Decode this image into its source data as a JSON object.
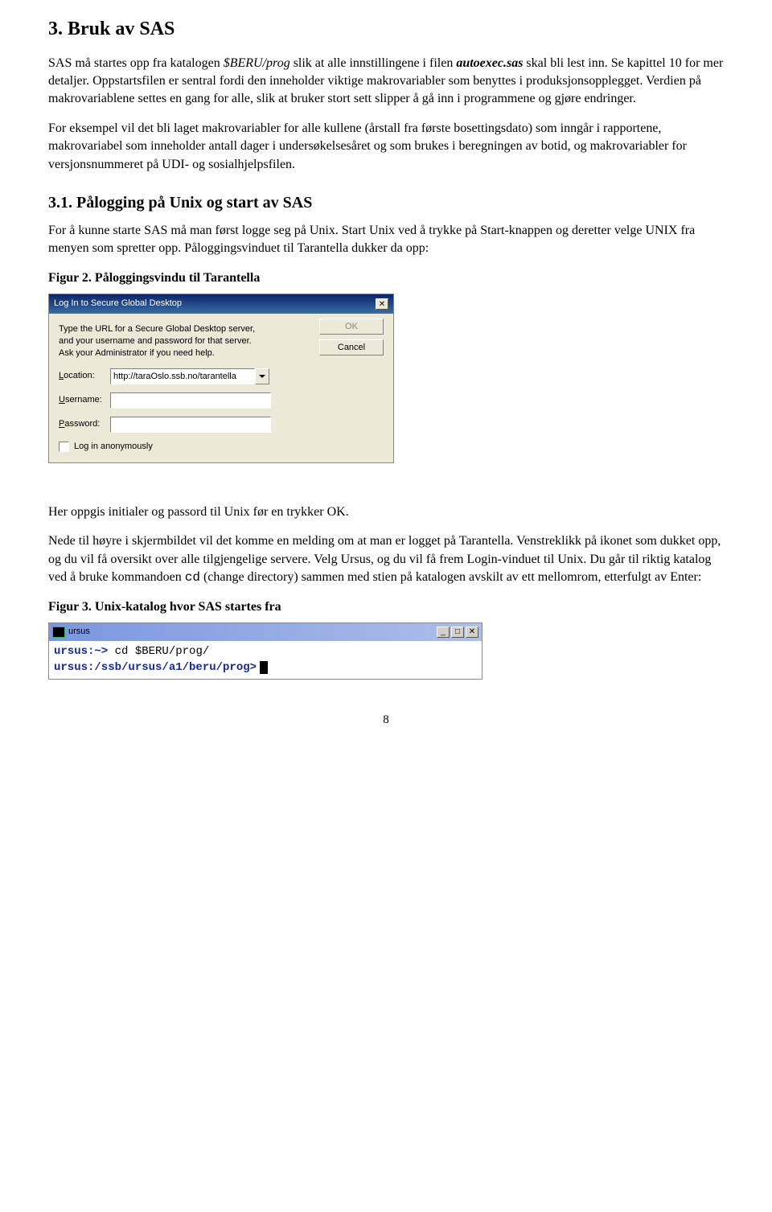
{
  "section": {
    "h1": "3. Bruk av SAS",
    "p1a": "SAS må startes opp fra katalogen ",
    "p1b": "$BERU/prog",
    "p1c": " slik at alle innstillingene i filen ",
    "p1d": "autoexec.sas",
    "p1e": " skal bli lest inn. Se kapittel 10 for mer detaljer. Oppstartsfilen er sentral fordi den inneholder viktige makrovariabler som benyttes i produksjonsopplegget. Verdien på makrovariablene settes en gang for alle, slik at bruker stort sett slipper å gå inn i programmene og gjøre endringer.",
    "p2": "For eksempel vil det bli laget makrovariabler for alle kullene (årstall fra første bosettingsdato) som inngår i rapportene, makrovariabel som inneholder antall dager i undersøkelsesåret og som brukes i beregningen av botid, og makrovariabler for versjonsnummeret på UDI- og sosialhjelpsfilen.",
    "h2": "3.1.  Pålogging på Unix og start av SAS",
    "p3": "For å kunne starte SAS må man først logge seg på Unix. Start Unix ved å trykke på Start-knappen og deretter velge UNIX fra menyen som spretter opp. Påloggingsvinduet til Tarantella dukker da opp:",
    "fig2": "Figur 2. Påloggingsvindu til Tarantella"
  },
  "dialog": {
    "title": "Log In to Secure Global Desktop",
    "desc": "Type the URL for a Secure Global Desktop server, and your username and password for that server. Ask your Administrator if you need help.",
    "ok": "OK",
    "cancel": "Cancel",
    "location_lbl_a": "L",
    "location_lbl_b": "ocation:",
    "location_val": "http://taraOslo.ssb.no/tarantella",
    "username_lbl_a": "U",
    "username_lbl_b": "sername:",
    "password_lbl_a": "P",
    "password_lbl_b": "assword:",
    "anon": "Log in anonymously"
  },
  "post": {
    "p4": "Her oppgis initialer og passord til Unix før en trykker OK.",
    "p5a": "Nede til høyre i skjermbildet vil det komme en melding om at man er logget på Tarantella. Venstreklikk på ikonet som dukket opp, og du vil få oversikt over alle tilgjengelige servere. Velg Ursus, og du vil få frem Login-vinduet til Unix. Du går til riktig katalog ved å bruke kommandoen ",
    "p5b": "cd",
    "p5c": " (change directory) sammen med stien på katalogen avskilt av ett mellomrom, etterfulgt av Enter:",
    "fig3": "Figur 3. Unix-katalog hvor SAS startes fra"
  },
  "term": {
    "title": "ursus",
    "line1a": "ursus:~> ",
    "line1b": "cd $BERU/prog/",
    "line2": "ursus:/ssb/ursus/a1/beru/prog>"
  },
  "page_num": "8"
}
